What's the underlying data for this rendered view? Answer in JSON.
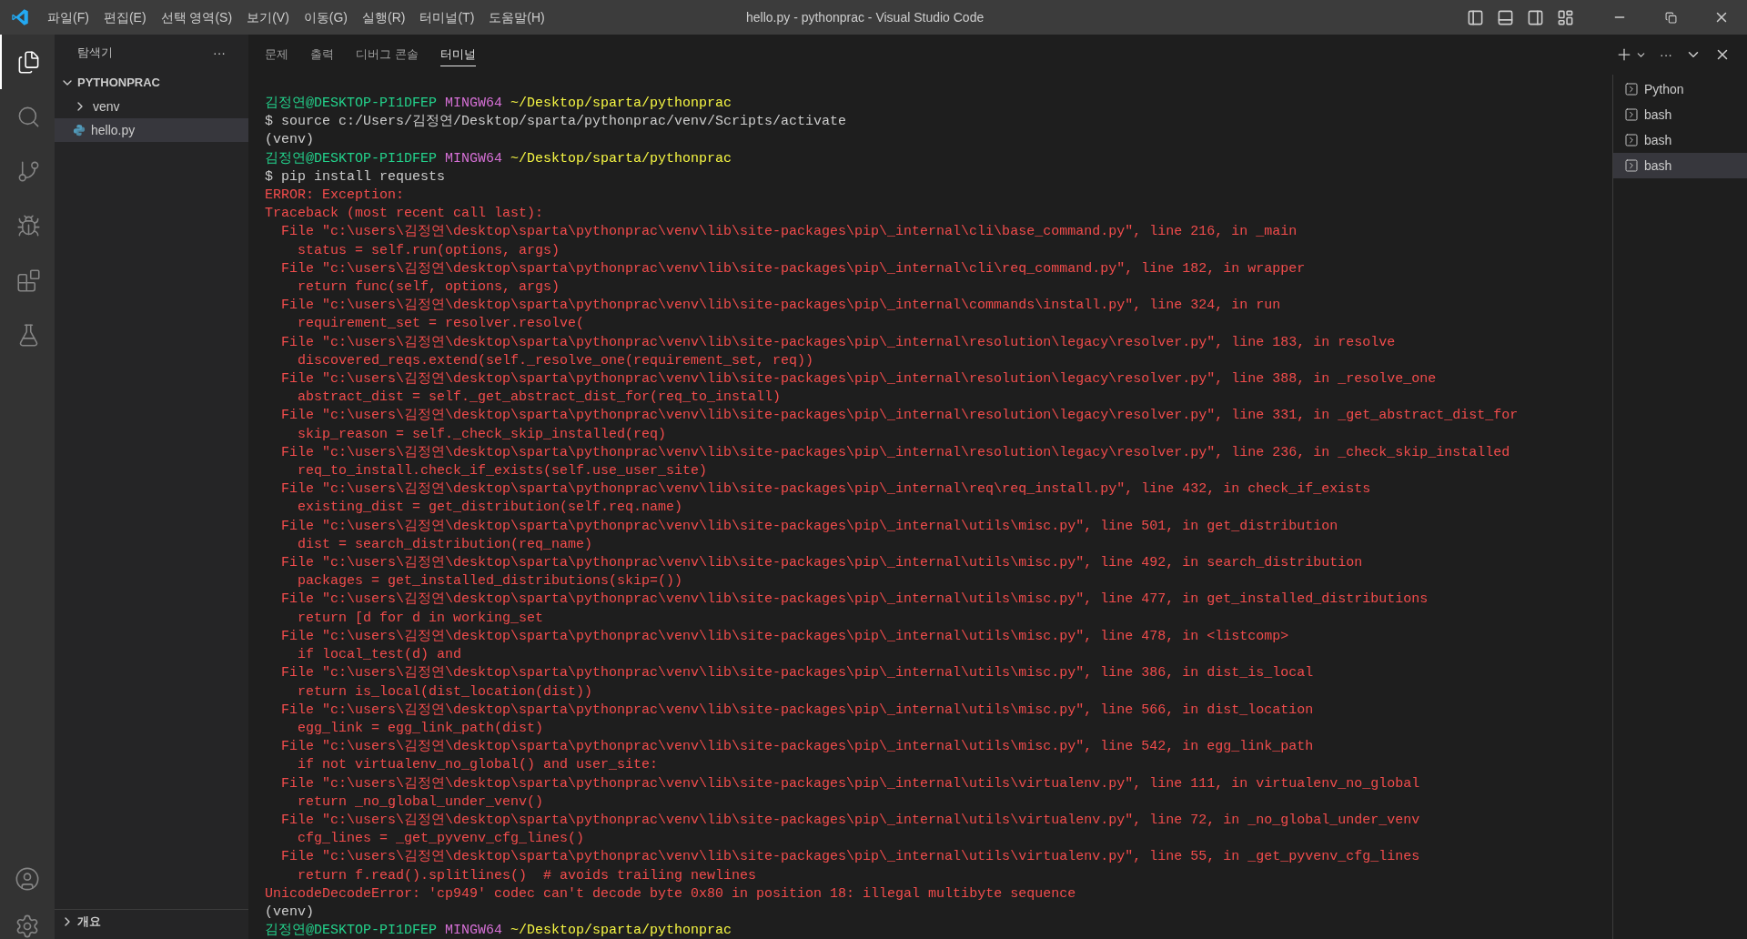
{
  "title_bar": {
    "menu": [
      "파일(F)",
      "편집(E)",
      "선택 영역(S)",
      "보기(V)",
      "이동(G)",
      "실행(R)",
      "터미널(T)",
      "도움말(H)"
    ],
    "title": "hello.py - pythonprac - Visual Studio Code"
  },
  "activity_bar": [
    {
      "kind": "explorer",
      "selected": true
    },
    {
      "kind": "search",
      "selected": false
    },
    {
      "kind": "source-control",
      "selected": false
    },
    {
      "kind": "run",
      "selected": false
    },
    {
      "kind": "extensions",
      "selected": false
    },
    {
      "kind": "testing",
      "selected": false
    }
  ],
  "sidebar": {
    "title": "탐색기",
    "actions": "···",
    "folder": {
      "label": "PYTHONPRAC",
      "expanded": true,
      "children": [
        {
          "label": "venv",
          "kind": "folder",
          "expanded": false,
          "selected": false
        },
        {
          "label": "hello.py",
          "kind": "python",
          "selected": true
        }
      ]
    },
    "outline": {
      "label": "개요",
      "expanded": false
    }
  },
  "panel": {
    "actions": "···",
    "tabs": [
      {
        "label": "문제",
        "selected": false
      },
      {
        "label": "출력",
        "selected": false
      },
      {
        "label": "디버그 콘솔",
        "selected": false
      },
      {
        "label": "터미널",
        "selected": true
      }
    ],
    "terminals": [
      {
        "label": "Python",
        "selected": false
      },
      {
        "label": "bash",
        "selected": false
      },
      {
        "label": "bash",
        "selected": false
      },
      {
        "label": "bash",
        "selected": true
      }
    ],
    "lines": [
      {
        "kind": "prompt",
        "user_host": "김정연@DESKTOP-PI1DFEP",
        "system": "MINGW64",
        "path": "~/Desktop/sparta/pythonprac"
      },
      {
        "kind": "plain",
        "text": "$ source c:/Users/김정연/Desktop/sparta/pythonprac/venv/Scripts/activate"
      },
      {
        "kind": "plain",
        "text": "(venv)"
      },
      {
        "kind": "prompt",
        "user_host": "김정연@DESKTOP-PI1DFEP",
        "system": "MINGW64",
        "path": "~/Desktop/sparta/pythonprac"
      },
      {
        "kind": "plain",
        "text": "$ pip install requests"
      },
      {
        "kind": "error",
        "text": "ERROR: Exception:"
      },
      {
        "kind": "error",
        "text": "Traceback (most recent call last):"
      },
      {
        "kind": "error",
        "text": "  File \"c:\\users\\김정연\\desktop\\sparta\\pythonprac\\venv\\lib\\site-packages\\pip\\_internal\\cli\\base_command.py\", line 216, in _main"
      },
      {
        "kind": "error",
        "text": "    status = self.run(options, args)"
      },
      {
        "kind": "error",
        "text": "  File \"c:\\users\\김정연\\desktop\\sparta\\pythonprac\\venv\\lib\\site-packages\\pip\\_internal\\cli\\req_command.py\", line 182, in wrapper"
      },
      {
        "kind": "error",
        "text": "    return func(self, options, args)"
      },
      {
        "kind": "error",
        "text": "  File \"c:\\users\\김정연\\desktop\\sparta\\pythonprac\\venv\\lib\\site-packages\\pip\\_internal\\commands\\install.py\", line 324, in run"
      },
      {
        "kind": "error",
        "text": "    requirement_set = resolver.resolve("
      },
      {
        "kind": "error",
        "text": "  File \"c:\\users\\김정연\\desktop\\sparta\\pythonprac\\venv\\lib\\site-packages\\pip\\_internal\\resolution\\legacy\\resolver.py\", line 183, in resolve"
      },
      {
        "kind": "error",
        "text": "    discovered_reqs.extend(self._resolve_one(requirement_set, req))"
      },
      {
        "kind": "error",
        "text": "  File \"c:\\users\\김정연\\desktop\\sparta\\pythonprac\\venv\\lib\\site-packages\\pip\\_internal\\resolution\\legacy\\resolver.py\", line 388, in _resolve_one"
      },
      {
        "kind": "error",
        "text": "    abstract_dist = self._get_abstract_dist_for(req_to_install)"
      },
      {
        "kind": "error",
        "text": "  File \"c:\\users\\김정연\\desktop\\sparta\\pythonprac\\venv\\lib\\site-packages\\pip\\_internal\\resolution\\legacy\\resolver.py\", line 331, in _get_abstract_dist_for"
      },
      {
        "kind": "error",
        "text": "    skip_reason = self._check_skip_installed(req)"
      },
      {
        "kind": "error",
        "text": "  File \"c:\\users\\김정연\\desktop\\sparta\\pythonprac\\venv\\lib\\site-packages\\pip\\_internal\\resolution\\legacy\\resolver.py\", line 236, in _check_skip_installed"
      },
      {
        "kind": "error",
        "text": "    req_to_install.check_if_exists(self.use_user_site)"
      },
      {
        "kind": "error",
        "text": "  File \"c:\\users\\김정연\\desktop\\sparta\\pythonprac\\venv\\lib\\site-packages\\pip\\_internal\\req\\req_install.py\", line 432, in check_if_exists"
      },
      {
        "kind": "error",
        "text": "    existing_dist = get_distribution(self.req.name)"
      },
      {
        "kind": "error",
        "text": "  File \"c:\\users\\김정연\\desktop\\sparta\\pythonprac\\venv\\lib\\site-packages\\pip\\_internal\\utils\\misc.py\", line 501, in get_distribution"
      },
      {
        "kind": "error",
        "text": "    dist = search_distribution(req_name)"
      },
      {
        "kind": "error",
        "text": "  File \"c:\\users\\김정연\\desktop\\sparta\\pythonprac\\venv\\lib\\site-packages\\pip\\_internal\\utils\\misc.py\", line 492, in search_distribution"
      },
      {
        "kind": "error",
        "text": "    packages = get_installed_distributions(skip=())"
      },
      {
        "kind": "error",
        "text": "  File \"c:\\users\\김정연\\desktop\\sparta\\pythonprac\\venv\\lib\\site-packages\\pip\\_internal\\utils\\misc.py\", line 477, in get_installed_distributions"
      },
      {
        "kind": "error",
        "text": "    return [d for d in working_set"
      },
      {
        "kind": "error",
        "text": "  File \"c:\\users\\김정연\\desktop\\sparta\\pythonprac\\venv\\lib\\site-packages\\pip\\_internal\\utils\\misc.py\", line 478, in <listcomp>"
      },
      {
        "kind": "error",
        "text": "    if local_test(d) and"
      },
      {
        "kind": "error",
        "text": "  File \"c:\\users\\김정연\\desktop\\sparta\\pythonprac\\venv\\lib\\site-packages\\pip\\_internal\\utils\\misc.py\", line 386, in dist_is_local"
      },
      {
        "kind": "error",
        "text": "    return is_local(dist_location(dist))"
      },
      {
        "kind": "error",
        "text": "  File \"c:\\users\\김정연\\desktop\\sparta\\pythonprac\\venv\\lib\\site-packages\\pip\\_internal\\utils\\misc.py\", line 566, in dist_location"
      },
      {
        "kind": "error",
        "text": "    egg_link = egg_link_path(dist)"
      },
      {
        "kind": "error",
        "text": "  File \"c:\\users\\김정연\\desktop\\sparta\\pythonprac\\venv\\lib\\site-packages\\pip\\_internal\\utils\\misc.py\", line 542, in egg_link_path"
      },
      {
        "kind": "error",
        "text": "    if not virtualenv_no_global() and user_site:"
      },
      {
        "kind": "error",
        "text": "  File \"c:\\users\\김정연\\desktop\\sparta\\pythonprac\\venv\\lib\\site-packages\\pip\\_internal\\utils\\virtualenv.py\", line 111, in virtualenv_no_global"
      },
      {
        "kind": "error",
        "text": "    return _no_global_under_venv()"
      },
      {
        "kind": "error",
        "text": "  File \"c:\\users\\김정연\\desktop\\sparta\\pythonprac\\venv\\lib\\site-packages\\pip\\_internal\\utils\\virtualenv.py\", line 72, in _no_global_under_venv"
      },
      {
        "kind": "error",
        "text": "    cfg_lines = _get_pyvenv_cfg_lines()"
      },
      {
        "kind": "error",
        "text": "  File \"c:\\users\\김정연\\desktop\\sparta\\pythonprac\\venv\\lib\\site-packages\\pip\\_internal\\utils\\virtualenv.py\", line 55, in _get_pyvenv_cfg_lines"
      },
      {
        "kind": "error",
        "text": "    return f.read().splitlines()  # avoids trailing newlines"
      },
      {
        "kind": "error",
        "text": "UnicodeDecodeError: 'cp949' codec can't decode byte 0x80 in position 18: illegal multibyte sequence"
      },
      {
        "kind": "plain",
        "text": "(venv)"
      },
      {
        "kind": "prompt",
        "user_host": "김정연@DESKTOP-PI1DFEP",
        "system": "MINGW64",
        "path": "~/Desktop/sparta/pythonprac"
      }
    ]
  }
}
